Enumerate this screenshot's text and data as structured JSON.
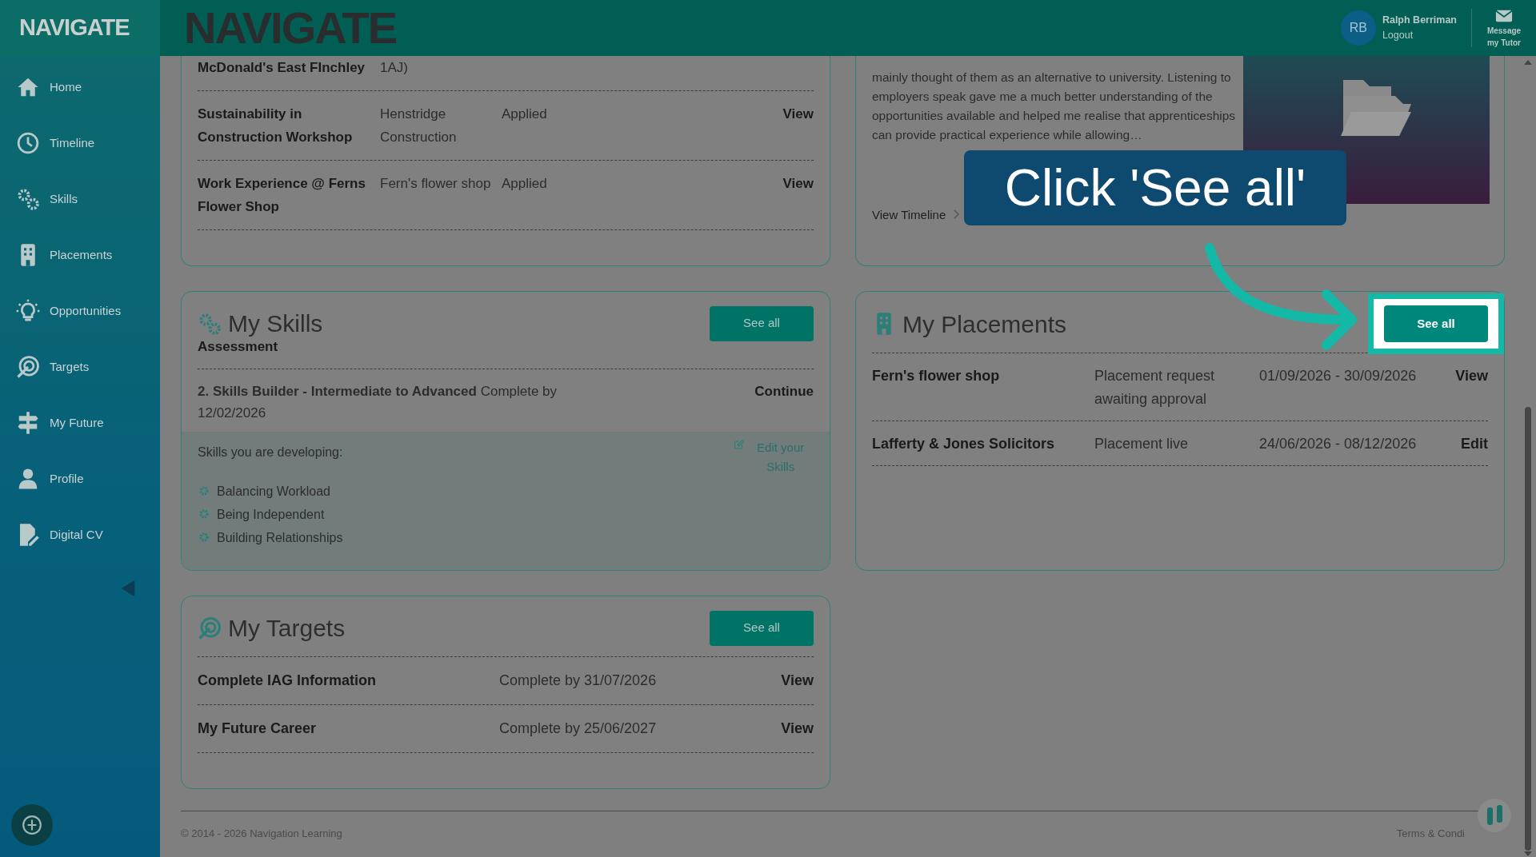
{
  "sidebar": {
    "logo": "NAVIGATE",
    "items": [
      {
        "label": "Home"
      },
      {
        "label": "Timeline"
      },
      {
        "label": "Skills"
      },
      {
        "label": "Placements"
      },
      {
        "label": "Opportunities"
      },
      {
        "label": "Targets"
      },
      {
        "label": "My Future"
      },
      {
        "label": "Profile"
      },
      {
        "label": "Digital CV"
      }
    ]
  },
  "header": {
    "logo": "NAVIGATE",
    "user": {
      "initials": "RB",
      "name": "Ralph Berriman",
      "logout": "Logout"
    },
    "message": "Message my Tutor"
  },
  "opportunities_card": {
    "rows": [
      {
        "title": "McDonald's East FInchley",
        "organisation": "1AJ)"
      },
      {
        "title": "Sustainability in Construction Workshop",
        "organisation": "Henstridge Construction",
        "status": "Applied",
        "action": "View"
      },
      {
        "title": "Work Experience @ Ferns Flower Shop",
        "organisation": "Fern's flower shop",
        "status": "Applied",
        "action": "View"
      }
    ]
  },
  "timeline_card": {
    "text": "mainly thought of them as an alternative to university. Listening to employers speak gave me a much better understanding of the opportunities available and helped me realise that apprenticeships can provide practical experience while allowing…",
    "link": "View Timeline"
  },
  "skills_card": {
    "title": "My Skills",
    "button": {
      "label": "See all",
      "highlighted": false
    },
    "subtitle": "Assessment",
    "assessment": {
      "text": "**2. Skills Builder - Intermediate to Advanced** Complete by 12/02/2026",
      "action": "Continue"
    },
    "developing_label": "Skills you are developing:",
    "edit_link": "Edit your Skills",
    "skills": [
      "Balancing Workload",
      "Being Independent",
      "Building Relationships"
    ]
  },
  "placements_card": {
    "title": "My Placements",
    "button": {
      "label": "See all",
      "highlighted": true
    },
    "rows": [
      {
        "name": "Fern's flower shop",
        "status": "Placement request awaiting approval",
        "dates": "01/09/2026 - 30/09/2026",
        "action": "View"
      },
      {
        "name": "Lafferty & Jones Solicitors",
        "status": "Placement live",
        "dates": "24/06/2026 - 08/12/2026",
        "action": "Edit"
      }
    ]
  },
  "targets_card": {
    "title": "My Targets",
    "button": {
      "label": "See all",
      "highlighted": false
    },
    "rows": [
      {
        "title": "Complete IAG Information",
        "due": "Complete by 31/07/2026",
        "action": "View"
      },
      {
        "title": "My Future Career",
        "due": "Complete by 25/06/2027",
        "action": "View"
      }
    ]
  },
  "footer": {
    "copyright": "© 2014 - 2026 Navigation Learning",
    "terms": "Terms & Condi"
  },
  "callout": {
    "text": "Click 'See all'"
  }
}
